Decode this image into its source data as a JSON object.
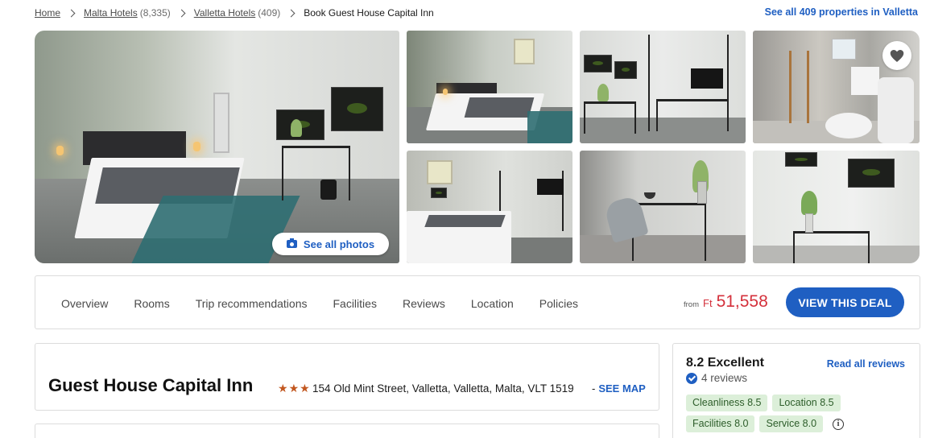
{
  "breadcrumb": {
    "items": [
      {
        "label": "Home",
        "count": ""
      },
      {
        "label": "Malta Hotels",
        "count": "(8,335)"
      },
      {
        "label": "Valletta Hotels",
        "count": "(409)"
      }
    ],
    "current": "Book Guest House Capital Inn"
  },
  "see_all_properties": "See all 409 properties in Valletta",
  "gallery": {
    "see_all_photos": "See all photos",
    "photos": [
      "bedroom-main",
      "bedroom-2",
      "wardrobe-desk",
      "bathroom",
      "bedroom-3",
      "desk-chair",
      "desk-plant"
    ],
    "favorite_icon": "heart-icon",
    "camera_icon": "camera-icon"
  },
  "nav": {
    "tabs": [
      "Overview",
      "Rooms",
      "Trip recommendations",
      "Facilities",
      "Reviews",
      "Location",
      "Policies"
    ],
    "price": {
      "from": "from",
      "currency": "Ft",
      "amount": "51,558",
      "color": "#d4303b"
    },
    "deal_button": "VIEW THIS DEAL"
  },
  "hotel": {
    "name": "Guest House Capital Inn",
    "stars": 3,
    "star_glyph": "★",
    "address": "154 Old Mint Street, Valletta, Valletta, Malta, VLT 1519",
    "separator": "-",
    "see_map": "SEE MAP"
  },
  "rating": {
    "score": "8.2 Excellent",
    "read_all": "Read all reviews",
    "reviews": "4 reviews",
    "chips": [
      {
        "label": "Cleanliness 8.5"
      },
      {
        "label": "Location 8.5"
      },
      {
        "label": "Facilities 8.0"
      },
      {
        "label": "Service 8.0"
      }
    ],
    "info_icon": "i"
  },
  "colors": {
    "accent": "#1f5fc2",
    "price": "#d4303b",
    "chip_bg": "#dcefd9",
    "star": "#c2571f"
  }
}
